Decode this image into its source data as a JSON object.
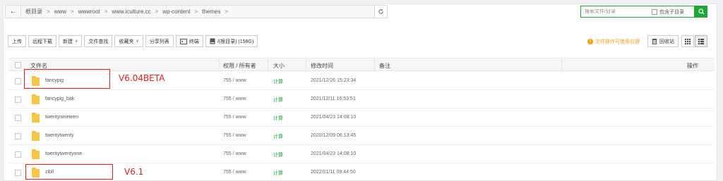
{
  "path_bar": {
    "crumbs": [
      "根目录",
      "www",
      "wwwroot",
      "www.iculture.cc",
      "wp-content",
      "themes"
    ]
  },
  "search": {
    "placeholder": "搜索文件/目录",
    "include_subdir_label": "包含子目录"
  },
  "toolbar": {
    "upload": "上传",
    "remote_download": "远程下载",
    "new": "新建",
    "file_search": "文件查找",
    "favorites": "收藏夹",
    "share_list": "分享列表",
    "terminal": "终端",
    "disk": "/(根目录) (158G)"
  },
  "right_tools": {
    "warning": "文件操作可使用右键",
    "recycle_bin": "回收站"
  },
  "table": {
    "headers": {
      "name": "文件名",
      "perm": "权限 / 所有者",
      "size": "大小",
      "mtime": "修改时间",
      "remark": "备注",
      "ops": "操作"
    },
    "rows": [
      {
        "name": "fancypig",
        "perm": "755 / www",
        "size": "计算",
        "mtime": "2021/12/26 15:23:34"
      },
      {
        "name": "fancypig_bak",
        "perm": "755 / www",
        "size": "计算",
        "mtime": "2021/12/11 16:53:51"
      },
      {
        "name": "twentynineteen",
        "perm": "755 / www",
        "size": "计算",
        "mtime": "2021/04/23 14:08:10"
      },
      {
        "name": "twentytwenty",
        "perm": "755 / www",
        "size": "计算",
        "mtime": "2020/12/09 06:13:45"
      },
      {
        "name": "twentytwentyone",
        "perm": "755 / www",
        "size": "计算",
        "mtime": "2021/04/23 14:08:10"
      },
      {
        "name": "zibll",
        "perm": "755 / www",
        "size": "计算",
        "mtime": "2022/01/11 09:44:50"
      }
    ]
  },
  "annotations": {
    "note1": "V6.04BETA",
    "note2": "V6.1"
  },
  "colors": {
    "accent_green": "#20a53a",
    "annotation_red": "#e02020",
    "warning_orange": "#f39c12",
    "folder_yellow": "#f7c646"
  }
}
